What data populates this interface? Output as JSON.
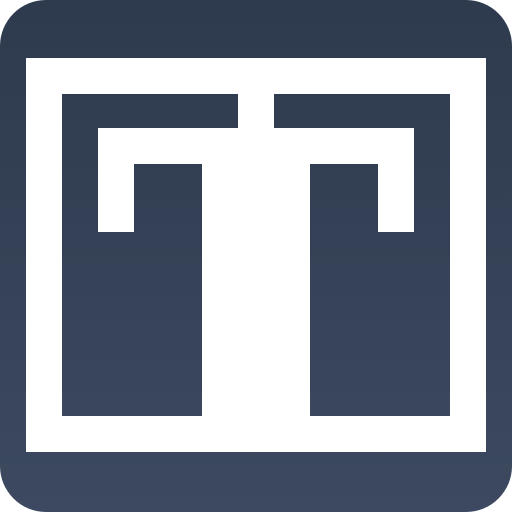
{
  "app_icon": {
    "icon_name": "greek-key-frame-icon",
    "colors": {
      "background_top": "#2E3A4D",
      "background_bottom": "#3C4960",
      "stroke": "#FFFFFF"
    }
  }
}
